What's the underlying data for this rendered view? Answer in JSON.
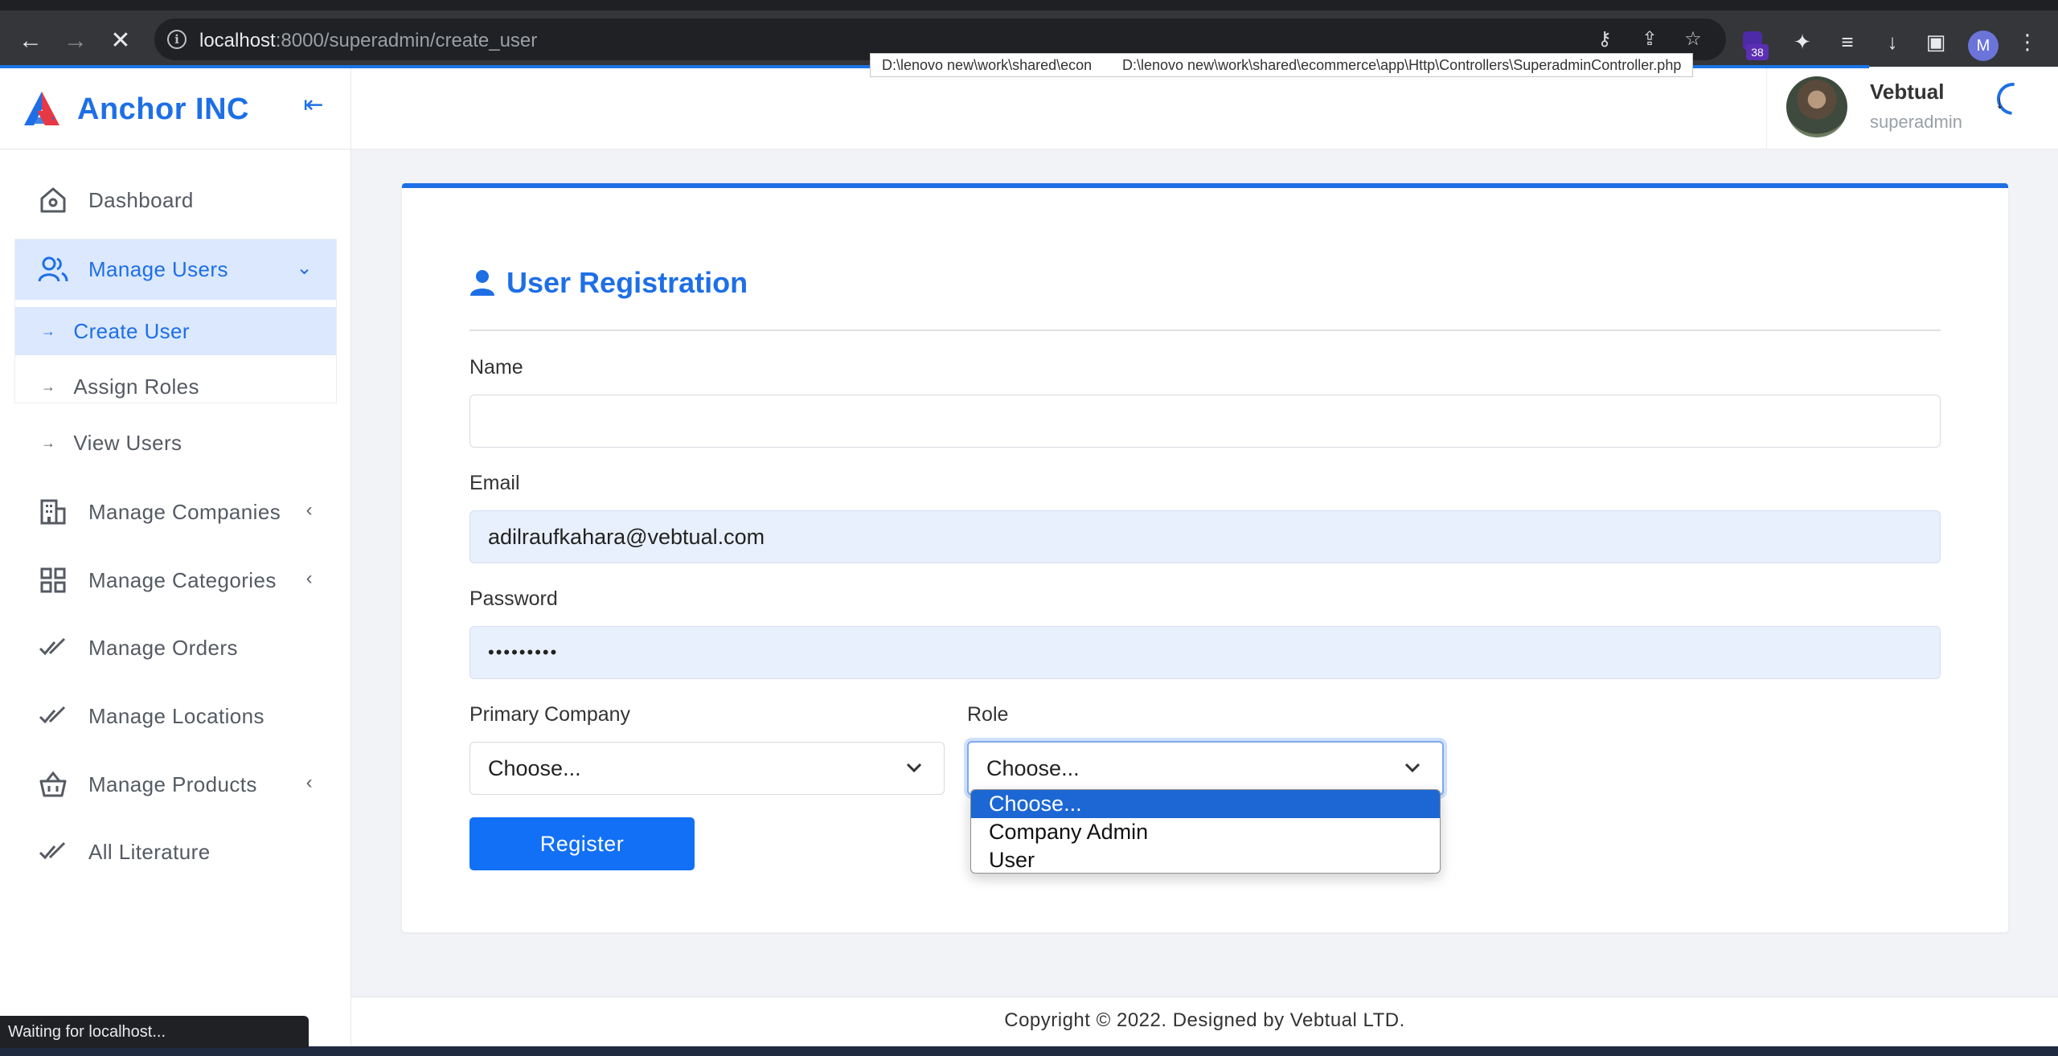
{
  "browser": {
    "url_host": "localhost",
    "url_path": ":8000/superadmin/create_user",
    "extension_badge": "38",
    "profile_initial": "M",
    "status_text": "Waiting for localhost...",
    "hover_path_1": "D:\\lenovo new\\work\\shared\\econ",
    "hover_path_2": "D:\\lenovo new\\work\\shared\\ecommerce\\app\\Http\\Controllers\\SuperadminController.php",
    "accent_color": "#1a73e8"
  },
  "brand": {
    "name": "Anchor INC",
    "color": "#1e6fe6"
  },
  "sidebar": {
    "items": [
      {
        "label": "Dashboard",
        "icon": "home-icon"
      },
      {
        "label": "Manage Users",
        "icon": "users-icon",
        "expanded": true
      },
      {
        "label": "Manage Companies",
        "icon": "building-icon"
      },
      {
        "label": "Manage Categories",
        "icon": "grid-icon"
      },
      {
        "label": "Manage Orders",
        "icon": "double-check-icon"
      },
      {
        "label": "Manage Locations",
        "icon": "double-check-icon"
      },
      {
        "label": "Manage Products",
        "icon": "basket-icon"
      },
      {
        "label": "All Literature",
        "icon": "double-check-icon"
      }
    ],
    "submenu": [
      {
        "label": "Create User",
        "active": true
      },
      {
        "label": "Assign Roles"
      },
      {
        "label": "View Users"
      }
    ]
  },
  "header": {
    "user_name": "Vebtual",
    "user_role": "superadmin"
  },
  "form": {
    "title": "User Registration",
    "name_label": "Name",
    "name_value": "",
    "email_label": "Email",
    "email_value": "adilraufkahara@vebtual.com",
    "password_label": "Password",
    "password_value": "•••••••••",
    "company_label": "Primary Company",
    "company_value": "Choose...",
    "role_label": "Role",
    "role_value": "Choose...",
    "role_options": [
      "Choose...",
      "Company Admin",
      "User"
    ],
    "submit_label": "Register"
  },
  "footer": {
    "text": "Copyright © 2022. Designed by Vebtual LTD."
  }
}
